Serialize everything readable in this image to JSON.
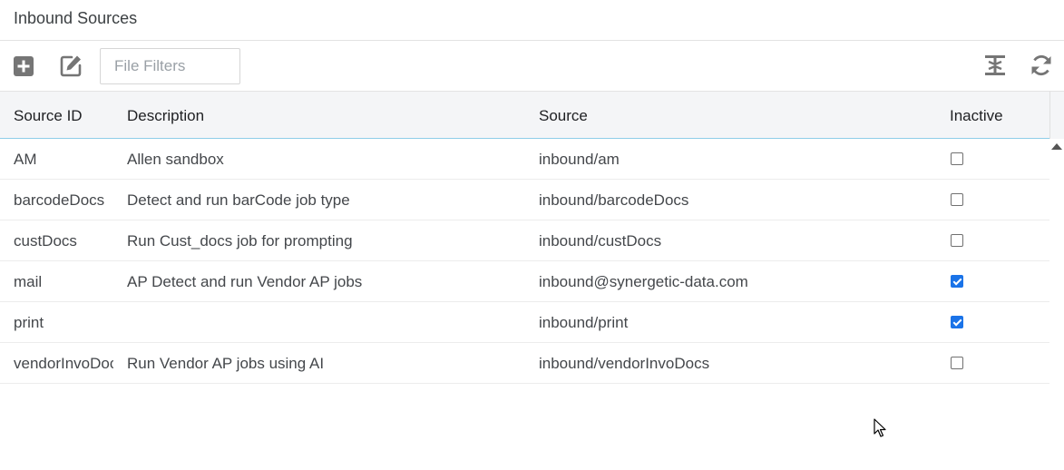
{
  "header": {
    "title": "Inbound Sources"
  },
  "toolbar": {
    "add_icon": "plus-square-icon",
    "edit_icon": "edit-icon",
    "filter_placeholder": "File Filters",
    "fit_icon": "text-height-icon",
    "refresh_icon": "refresh-icon"
  },
  "grid": {
    "columns": [
      "Source ID",
      "Description",
      "Source",
      "Inactive"
    ],
    "rows": [
      {
        "source_id": "AM",
        "description": "Allen sandbox",
        "source": "inbound/am",
        "inactive": false
      },
      {
        "source_id": "barcodeDocs",
        "description": "Detect and run barCode job type",
        "source": "inbound/barcodeDocs",
        "inactive": false
      },
      {
        "source_id": "custDocs",
        "description": "Run Cust_docs job for prompting",
        "source": "inbound/custDocs",
        "inactive": false
      },
      {
        "source_id": "mail",
        "description": "AP Detect and run Vendor AP jobs",
        "source": "inbound@synergetic-data.com",
        "inactive": true
      },
      {
        "source_id": "print",
        "description": "",
        "source": "inbound/print",
        "inactive": true
      },
      {
        "source_id": "vendorInvoDocs",
        "description": "Run Vendor AP jobs using AI",
        "source": "inbound/vendorInvoDocs",
        "inactive": false
      }
    ]
  },
  "colors": {
    "checkbox_checked": "#1a73e8",
    "header_bg": "#f4f5f7",
    "header_underline": "#8ecde8",
    "icon": "#757575"
  }
}
